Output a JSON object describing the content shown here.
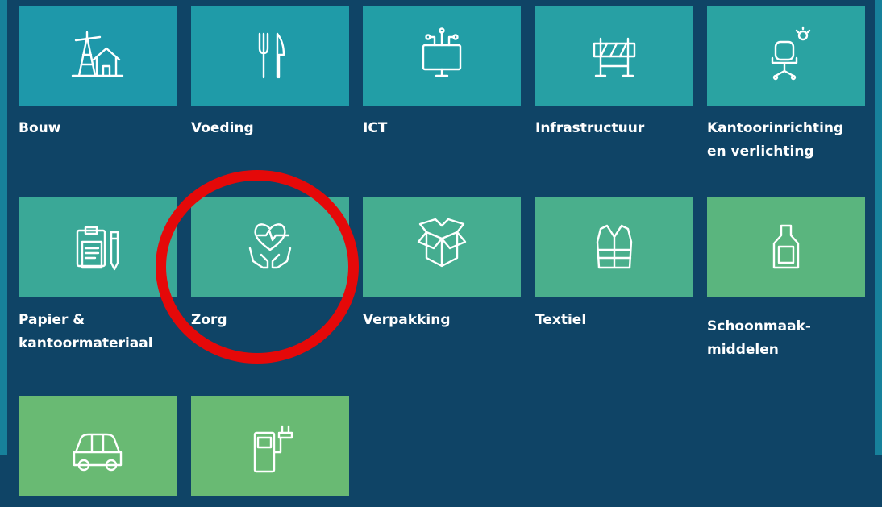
{
  "categories": [
    {
      "label": "Bouw",
      "icon": "construction-icon",
      "color": "#1e98aa"
    },
    {
      "label": "Voeding",
      "icon": "fork-knife-icon",
      "color": "#1f9ba8"
    },
    {
      "label": "ICT",
      "icon": "computer-network-icon",
      "color": "#229ea6"
    },
    {
      "label": "Infrastructuur",
      "icon": "road-barrier-icon",
      "color": "#27a0a4"
    },
    {
      "label": "Kantoorinrichting\nen verlichting",
      "icon": "office-chair-lamp-icon",
      "color": "#2aa3a2"
    },
    {
      "label": "Papier &\nkantoormateriaal",
      "icon": "clipboard-pencil-icon",
      "color": "#3aa897"
    },
    {
      "label": "Zorg",
      "icon": "heart-hands-icon",
      "color": "#40aa94"
    },
    {
      "label": "Verpakking",
      "icon": "box-icon",
      "color": "#45ad90"
    },
    {
      "label": "Textiel",
      "icon": "safety-vest-icon",
      "color": "#4aaf8c"
    },
    {
      "label": "Schoonmaak-\nmiddelen",
      "icon": "cleaning-bottle-icon",
      "color": "#5ab57e"
    },
    {
      "label": "",
      "icon": "car-icon",
      "color": "#69ba73"
    },
    {
      "label": "",
      "icon": "ev-charger-icon",
      "color": "#69ba73"
    }
  ],
  "highlight": {
    "target": "Zorg",
    "color": "#e50909"
  }
}
